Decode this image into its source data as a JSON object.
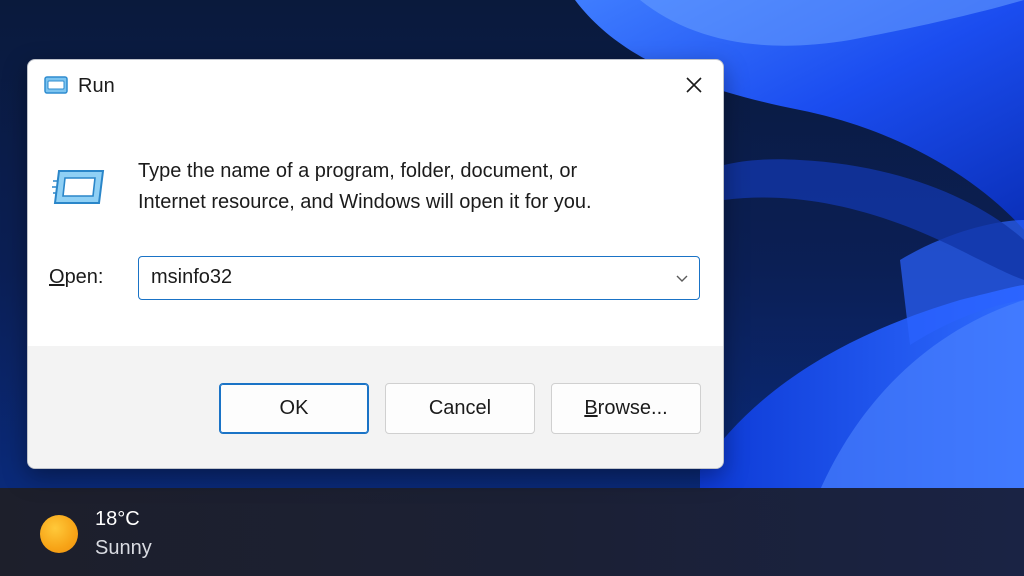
{
  "dialog": {
    "title": "Run",
    "description_line1": "Type the name of a program, folder, document, or",
    "description_line2": "Internet resource, and Windows will open it for you.",
    "open_label_accel": "O",
    "open_label_rest": "pen:",
    "input_value": "msinfo32",
    "buttons": {
      "ok": "OK",
      "cancel": "Cancel",
      "browse_accel": "B",
      "browse_rest": "rowse..."
    }
  },
  "taskbar": {
    "weather_temp": "18°C",
    "weather_desc": "Sunny"
  },
  "colors": {
    "accent": "#1a73c6",
    "wallpaper_blue": "#1e5cff",
    "taskbar": "#1d1f2b"
  },
  "icons": {
    "run_icon": "run-icon",
    "close_icon": "close-icon",
    "dropdown_icon": "chevron-down-icon",
    "weather_icon": "sun-icon"
  }
}
